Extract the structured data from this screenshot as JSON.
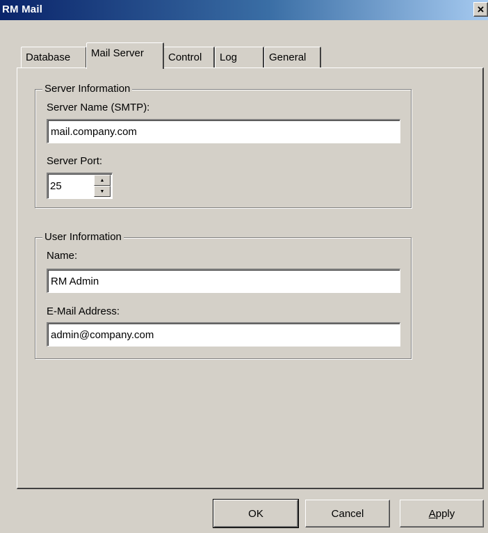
{
  "window": {
    "title": "RM Mail",
    "close_label": "×"
  },
  "tabs": [
    {
      "label": "Database",
      "active": false
    },
    {
      "label": "Mail Server",
      "active": true
    },
    {
      "label": "Control",
      "active": false
    },
    {
      "label": "Log",
      "active": false
    },
    {
      "label": "General",
      "active": false
    }
  ],
  "server_info": {
    "group_title": "Server Information",
    "server_name_label": "Server Name (SMTP):",
    "server_name_value": "mail.company.com",
    "server_port_label": "Server Port:",
    "server_port_value": "25"
  },
  "user_info": {
    "group_title": "User Information",
    "name_label": "Name:",
    "name_value": "RM Admin",
    "email_label": "E-Mail Address:",
    "email_value": "admin@company.com"
  },
  "buttons": {
    "ok_label": "OK",
    "cancel_label": "Cancel",
    "apply_mnemonic": "A",
    "apply_rest": "pply"
  },
  "icons": [
    "close-icon",
    "spin-up-icon",
    "spin-down-icon"
  ]
}
